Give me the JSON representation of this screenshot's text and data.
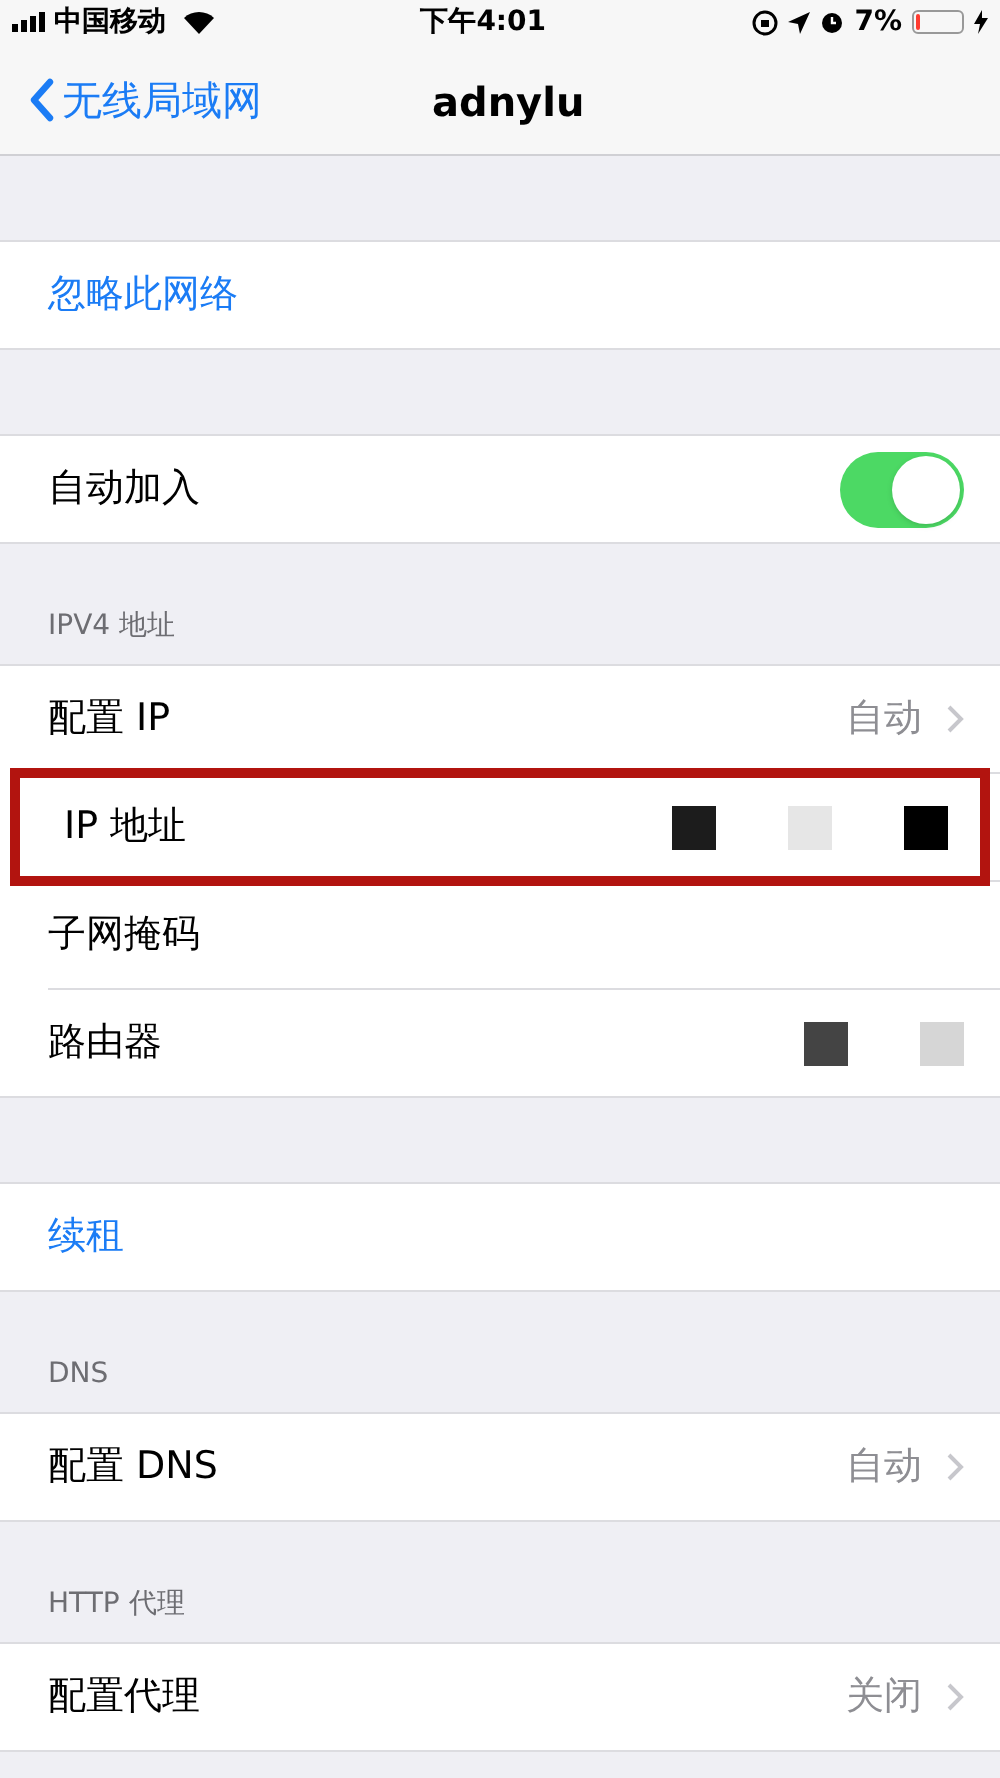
{
  "status_bar": {
    "carrier": "中国移动",
    "time": "下午4:01",
    "battery": "7%"
  },
  "nav": {
    "back": "无线局域网",
    "title": "adnylu"
  },
  "sections": [
    {
      "rows": [
        {
          "kind": "action",
          "label": "忽略此网络"
        }
      ]
    },
    {
      "rows": [
        {
          "kind": "toggle",
          "label": "自动加入",
          "on": true
        }
      ]
    },
    {
      "header": "IPV4 地址",
      "rows": [
        {
          "kind": "value",
          "label": "配置 IP",
          "value": "自动",
          "highlighted": false
        },
        {
          "kind": "redacted",
          "label": "IP 地址",
          "highlighted": true,
          "blocks": [
            {
              "color": "#1c1c1c"
            },
            {
              "color": "#e6e6e6"
            },
            {
              "color": "#000000"
            }
          ]
        },
        {
          "kind": "redacted",
          "label": "子网掩码",
          "highlighted": false
        },
        {
          "kind": "redacted",
          "label": "路由器",
          "highlighted": false,
          "blocks": [
            {
              "color": "#444444"
            },
            {
              "color": "#d6d6d6"
            }
          ]
        }
      ]
    },
    {
      "rows": [
        {
          "kind": "action",
          "label": "续租"
        }
      ]
    },
    {
      "header": "DNS",
      "rows": [
        {
          "kind": "value",
          "label": "配置 DNS",
          "value": "自动",
          "highlighted": false
        }
      ]
    },
    {
      "header": "HTTP 代理",
      "rows": [
        {
          "kind": "value",
          "label": "配置代理",
          "value": "关闭",
          "highlighted": false
        }
      ]
    }
  ]
}
